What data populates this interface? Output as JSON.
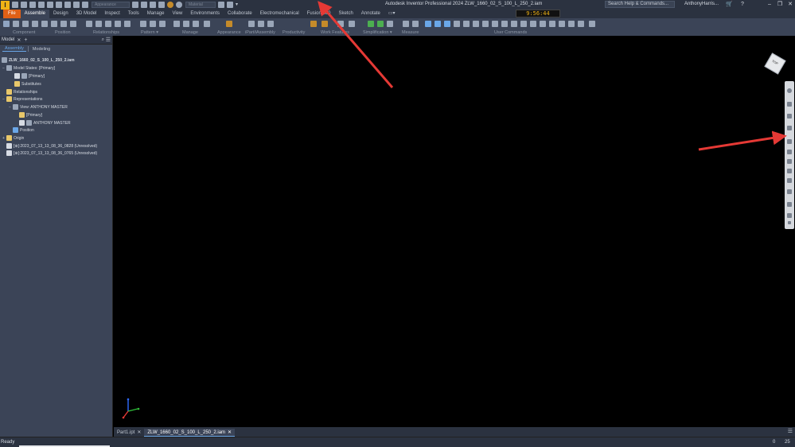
{
  "titlebar": {
    "app_title": "Autodesk Inventor Professional 2024   ZLW_1660_02_S_100_L_250_2.iam",
    "appearance_placeholder": "Appearance",
    "material_placeholder": "Material",
    "search_placeholder": "Search Help & Commands...",
    "user_name": "AnthonyHarris..."
  },
  "tabs": [
    {
      "label": "File"
    },
    {
      "label": "Assemble"
    },
    {
      "label": "Design"
    },
    {
      "label": "3D Model"
    },
    {
      "label": "Inspect"
    },
    {
      "label": "Tools"
    },
    {
      "label": "Manage"
    },
    {
      "label": "View"
    },
    {
      "label": "Environments"
    },
    {
      "label": "Collaborate"
    },
    {
      "label": "Electromechanical"
    },
    {
      "label": "Fusion 360"
    },
    {
      "label": "Sketch"
    },
    {
      "label": "Annotate"
    }
  ],
  "clock": "9:56:44",
  "ribbon_groups": [
    {
      "label": "Component"
    },
    {
      "label": "Position"
    },
    {
      "label": "Relationships"
    },
    {
      "label": "Pattern ▾"
    },
    {
      "label": "Manage"
    },
    {
      "label": "Appearance"
    },
    {
      "label": "iPart/iAssembly"
    },
    {
      "label": "Productivity"
    },
    {
      "label": "Work Features"
    },
    {
      "label": "Simplification ▾"
    },
    {
      "label": "Measure"
    },
    {
      "label": "User Commands"
    }
  ],
  "browser": {
    "title": "Model",
    "subtabs": [
      {
        "label": "Assembly"
      },
      {
        "label": "Modeling"
      }
    ],
    "tree": [
      {
        "label": "ZLW_1660_02_S_100_L_250_2.iam",
        "expander": ""
      },
      {
        "label": "Model States: [Primary]",
        "expander": "−"
      },
      {
        "label": "[Primary]",
        "expander": ""
      },
      {
        "label": "Substitutes",
        "expander": ""
      },
      {
        "label": "Relationships",
        "expander": ""
      },
      {
        "label": "Representations",
        "expander": "−"
      },
      {
        "label": "View: ANTHONY MASTER",
        "expander": "−"
      },
      {
        "label": "[Primary]",
        "expander": ""
      },
      {
        "label": "ANTHONY MASTER",
        "expander": ""
      },
      {
        "label": "Position",
        "expander": ""
      },
      {
        "label": "Origin",
        "expander": "+"
      },
      {
        "label": "[⊕]:2023_07_13_13_08_36_0828 (Unresolved)",
        "expander": ""
      },
      {
        "label": "[⊕]:2023_07_13_13_08_36_0765 (Unresolved)",
        "expander": ""
      }
    ]
  },
  "viewcube_label": "TOP",
  "doc_tabs": [
    {
      "label": "Part1.ipt"
    },
    {
      "label": "ZLW_1660_02_S_100_L_250_2.iam"
    }
  ],
  "status": {
    "text": "Ready",
    "count_a": "0",
    "count_b": "25"
  },
  "colors": {
    "accent": "#e06016",
    "annotation_arrow": "#e53935",
    "selection_blue": "#6aa7e8"
  }
}
